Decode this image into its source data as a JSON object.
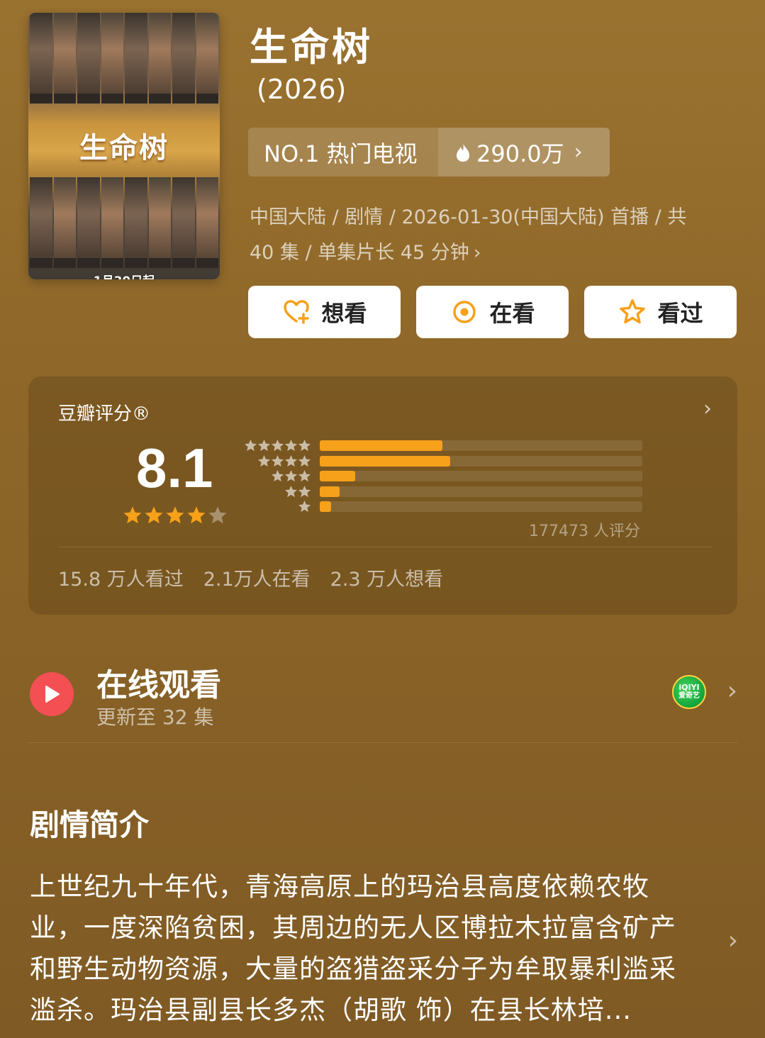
{
  "poster": {
    "title_art": "生命树",
    "date_text": "1月30日起"
  },
  "title": "生命树",
  "year": "(2026)",
  "rank": {
    "label": "NO.1 热门电视",
    "heat": "290.0万",
    "heat_icon": "fire-icon"
  },
  "meta": {
    "line1": "中国大陆 / 剧情 / 2026-01-30(中国大陆) 首播 / 共",
    "line2": "40 集 / 单集片长 45 分钟"
  },
  "actions": [
    {
      "label": "想看",
      "icon": "heart-plus-icon"
    },
    {
      "label": "在看",
      "icon": "target-icon"
    },
    {
      "label": "看过",
      "icon": "star-outline-icon"
    }
  ],
  "rating": {
    "label": "豆瓣评分®",
    "score": "8.1",
    "stars": 4,
    "distribution": [
      {
        "stars": 5,
        "fraction": 0.38
      },
      {
        "stars": 4,
        "fraction": 0.405
      },
      {
        "stars": 3,
        "fraction": 0.11
      },
      {
        "stars": 2,
        "fraction": 0.062
      },
      {
        "stars": 1,
        "fraction": 0.035
      }
    ],
    "count": "177473 人评分",
    "stats": [
      "15.8 万人看过",
      "2.1万人在看",
      "2.3 万人想看"
    ]
  },
  "watch": {
    "title": "在线观看",
    "subtitle": "更新至 32 集",
    "platform": "爱奇艺",
    "platform_logo": "iQIYI"
  },
  "synopsis": {
    "heading": "剧情简介",
    "text": "上世纪九十年代，青海高原上的玛治县高度依赖农牧业，一度深陷贫困，其周边的无人区博拉木拉富含矿产和野生动物资源，大量的盗猎盗采分子为牟取暴利滥采滥杀。玛治县副县长多杰（胡歌 饰）在县长林培..."
  },
  "colors": {
    "background": "#8d6628",
    "accent_orange": "#f7a01a",
    "play_red": "#f44f52"
  }
}
